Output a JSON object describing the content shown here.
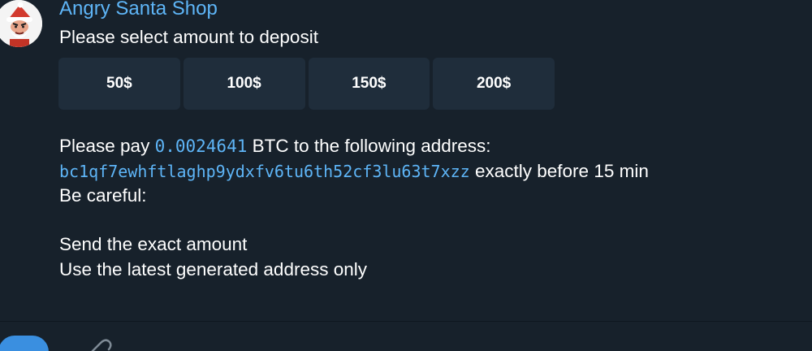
{
  "chat": {
    "sender_name": "Angry Santa Shop",
    "avatar_icon": "santa-avatar-icon",
    "prompt_text": "Please select amount to deposit"
  },
  "deposit_options": [
    {
      "label": "50$"
    },
    {
      "label": "100$"
    },
    {
      "label": "150$"
    },
    {
      "label": "200$"
    }
  ],
  "payment": {
    "pay_prefix": "Please pay ",
    "amount": "0.0024641",
    "pay_suffix": " BTC to the following address:",
    "address": "bc1qf7ewhftlaghp9ydxfv6tu6th52cf3lu63t7xzz",
    "deadline_text": " exactly before 15 min",
    "careful_text": " Be careful:",
    "rule_1": "Send the exact amount",
    "rule_2": "Use the latest generated address only"
  },
  "colors": {
    "background": "#17212b",
    "accent": "#5eb5f7",
    "button_bg": "#1f2d3b"
  }
}
